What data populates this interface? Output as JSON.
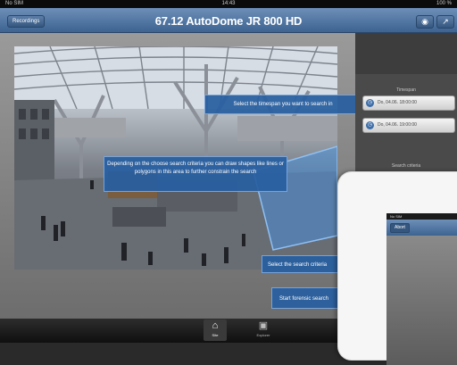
{
  "status_bar": {
    "carrier": "No SIM",
    "time": "14:43",
    "battery": "100 %"
  },
  "nav": {
    "back_label": "Recordings",
    "title": "67.12 AutoDome JR 800 HD",
    "btn1_icon": "search-icon",
    "btn2_icon": "export-icon"
  },
  "side_panel": {
    "timespan_label": "Timespan",
    "from_value": "Do, 04.06.  18:00:00",
    "to_value": "Do, 04.06.  19:00:00",
    "criteria_label": "Search criteria"
  },
  "tooltips": {
    "timespan": "Select the timespan you want to search in",
    "shapes": "Depending on the choose search criteria you can draw shapes like lines or polygons in this area to further constrain the search",
    "criteria": "Select the search criteria",
    "start": "Start forensic search"
  },
  "tabs": [
    {
      "label": "Site",
      "icon": "home-icon",
      "selected": true
    },
    {
      "label": "Explorer",
      "icon": "explorer-icon",
      "selected": false
    }
  ],
  "second_device": {
    "carrier": "No SIM",
    "back_label": "Abort"
  },
  "colors": {
    "nav_blue": "#3d6391",
    "tooltip_blue": "#285fa0",
    "search_area": "#4a8fd8"
  }
}
